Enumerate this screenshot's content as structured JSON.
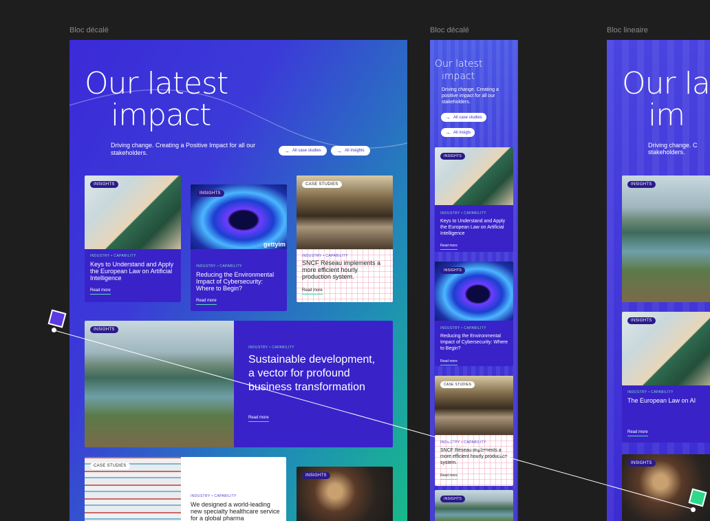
{
  "frames": [
    {
      "label": "Bloc décalé"
    },
    {
      "label": "Bloc décalé"
    },
    {
      "label": "Bloc lineaire"
    }
  ],
  "hero": {
    "title_line1": "Our latest",
    "title_line2": "impact",
    "subtitle": "Driving change. Creating a Positive Impact for all our stakeholders.",
    "subtitle_short": "Driving change. Creating a positive impact for all our stakeholders.",
    "btn_case": "All case studies",
    "btn_insights": "All insights",
    "btn_insights_alt": "All insigts",
    "title3_line1": "Our la",
    "title3_line2": "im",
    "subtitle3_a": "Driving change. C",
    "subtitle3_b": "stakeholders."
  },
  "cards": {
    "eu_law": {
      "tag": "INSIGHTS",
      "meta": "INDUSTRY  •  CAPABILITY",
      "title": "Keys to Understand and Apply the European Law on Artificial Intelligence",
      "more": "Read more"
    },
    "cyber": {
      "tag": "INSIGHTS",
      "meta": "INDUSTRY  •  CAPABILITY",
      "title": "Reducing the Environmental Impact of Cybersecurity: Where to Begin?",
      "more": "Read more",
      "watermark": "gettyim"
    },
    "sncf": {
      "tag": "CASE STUDIES",
      "meta": "INDUSTRY  •  CAPABILITY",
      "title": "SNCF Réseau implements a more efficient hourly production system.",
      "more": "Read more"
    },
    "sustain": {
      "tag": "INSIGHTS",
      "meta": "INDUSTRY  •  CAPABILITY",
      "title": "Sustainable development, a vector for profound business transformation",
      "more": "Read more"
    },
    "pharma": {
      "tag": "CASE STUDIES",
      "meta": "INDUSTRY  •  CAPABILITY",
      "title": "We designed a world-leading new specialty healthcare service for a global pharma"
    },
    "shop": {
      "tag": "INSIGHTS"
    },
    "eu_short": {
      "tag": "INSIGHTS",
      "meta": "INDUSTRY  •  CAPABILITY",
      "title": "The European Law on AI",
      "more": "Read more"
    }
  },
  "colors": {
    "accent": "#3b2ad8",
    "green": "#18b98a",
    "canvas": "#1e1e1e"
  }
}
